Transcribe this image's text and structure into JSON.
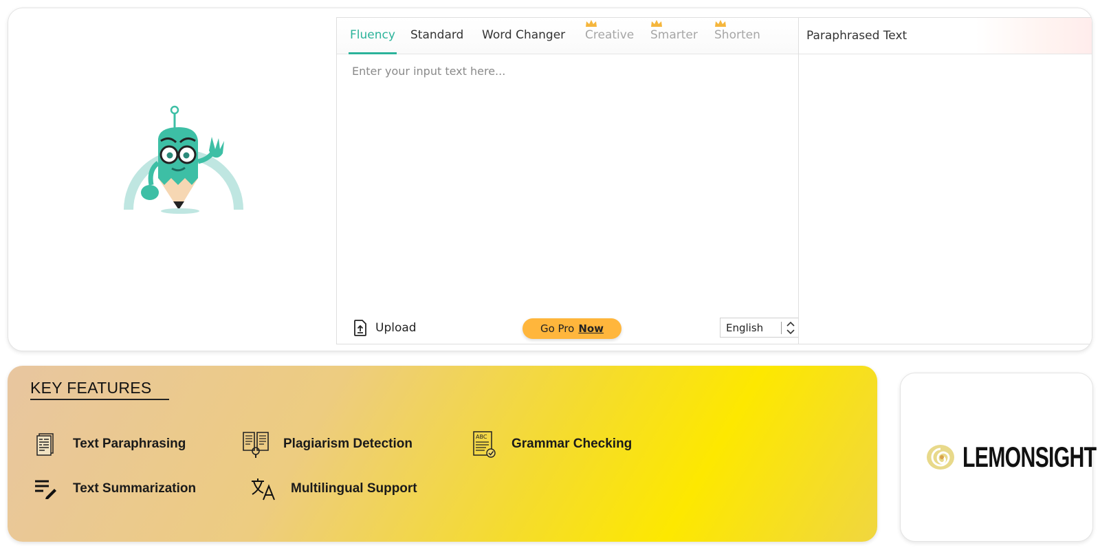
{
  "paraphraser": {
    "tabs": [
      {
        "label": "Fluency",
        "active": true,
        "pro": false
      },
      {
        "label": "Standard",
        "active": false,
        "pro": false
      },
      {
        "label": "Word Changer",
        "active": false,
        "pro": false
      },
      {
        "label": "Creative",
        "active": false,
        "pro": true
      },
      {
        "label": "Smarter",
        "active": false,
        "pro": true
      },
      {
        "label": "Shorten",
        "active": false,
        "pro": true
      }
    ],
    "input_placeholder": "Enter your input text here...",
    "upload_label": "Upload",
    "go_pro": {
      "text": "Go Pro",
      "link": "Now"
    },
    "language": {
      "selected": "English"
    },
    "output_title": "Paraphrased Text"
  },
  "features": {
    "title": "KEY FEATURES",
    "items": [
      {
        "label": "Text Paraphrasing",
        "icon": "document-list-icon"
      },
      {
        "label": "Plagiarism Detection",
        "icon": "book-compare-icon"
      },
      {
        "label": "Grammar Checking",
        "icon": "abc-check-icon"
      },
      {
        "label": "Text Summarization",
        "icon": "edit-lines-icon"
      },
      {
        "label": "Multilingual Support",
        "icon": "translate-icon"
      }
    ]
  },
  "brand": {
    "logo_text": "LEMONSIGHT",
    "logo_color": "#e8d98a"
  },
  "colors": {
    "accent": "#2bb39a",
    "go_pro": "#ffb63c",
    "pro_crown": "#f5b63c",
    "mascot": "#3dbfa5"
  }
}
